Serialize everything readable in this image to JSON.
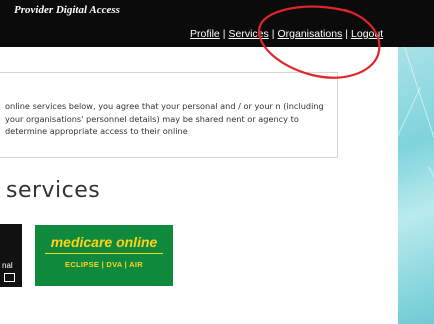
{
  "header": {
    "brand": "Provider Digital Access",
    "nav": [
      {
        "label": "Profile"
      },
      {
        "label": "Services"
      },
      {
        "label": "Organisations"
      },
      {
        "label": "Logout"
      }
    ],
    "separator": "|"
  },
  "notice": {
    "text": "online services below, you agree that your personal and / or your n (including your organisations' personnel details) may be shared nent or agency to determine appropriate access to their online"
  },
  "services": {
    "heading": "services",
    "tiles": [
      {
        "name": "partial-tile",
        "visible_text": "nal"
      },
      {
        "name": "medicare-online",
        "title": "medicare online",
        "subtitle": "ECLIPSE | DVA | AIR"
      }
    ]
  },
  "annotation": {
    "color": "#e0262b",
    "shape": "hand-drawn-circle"
  }
}
